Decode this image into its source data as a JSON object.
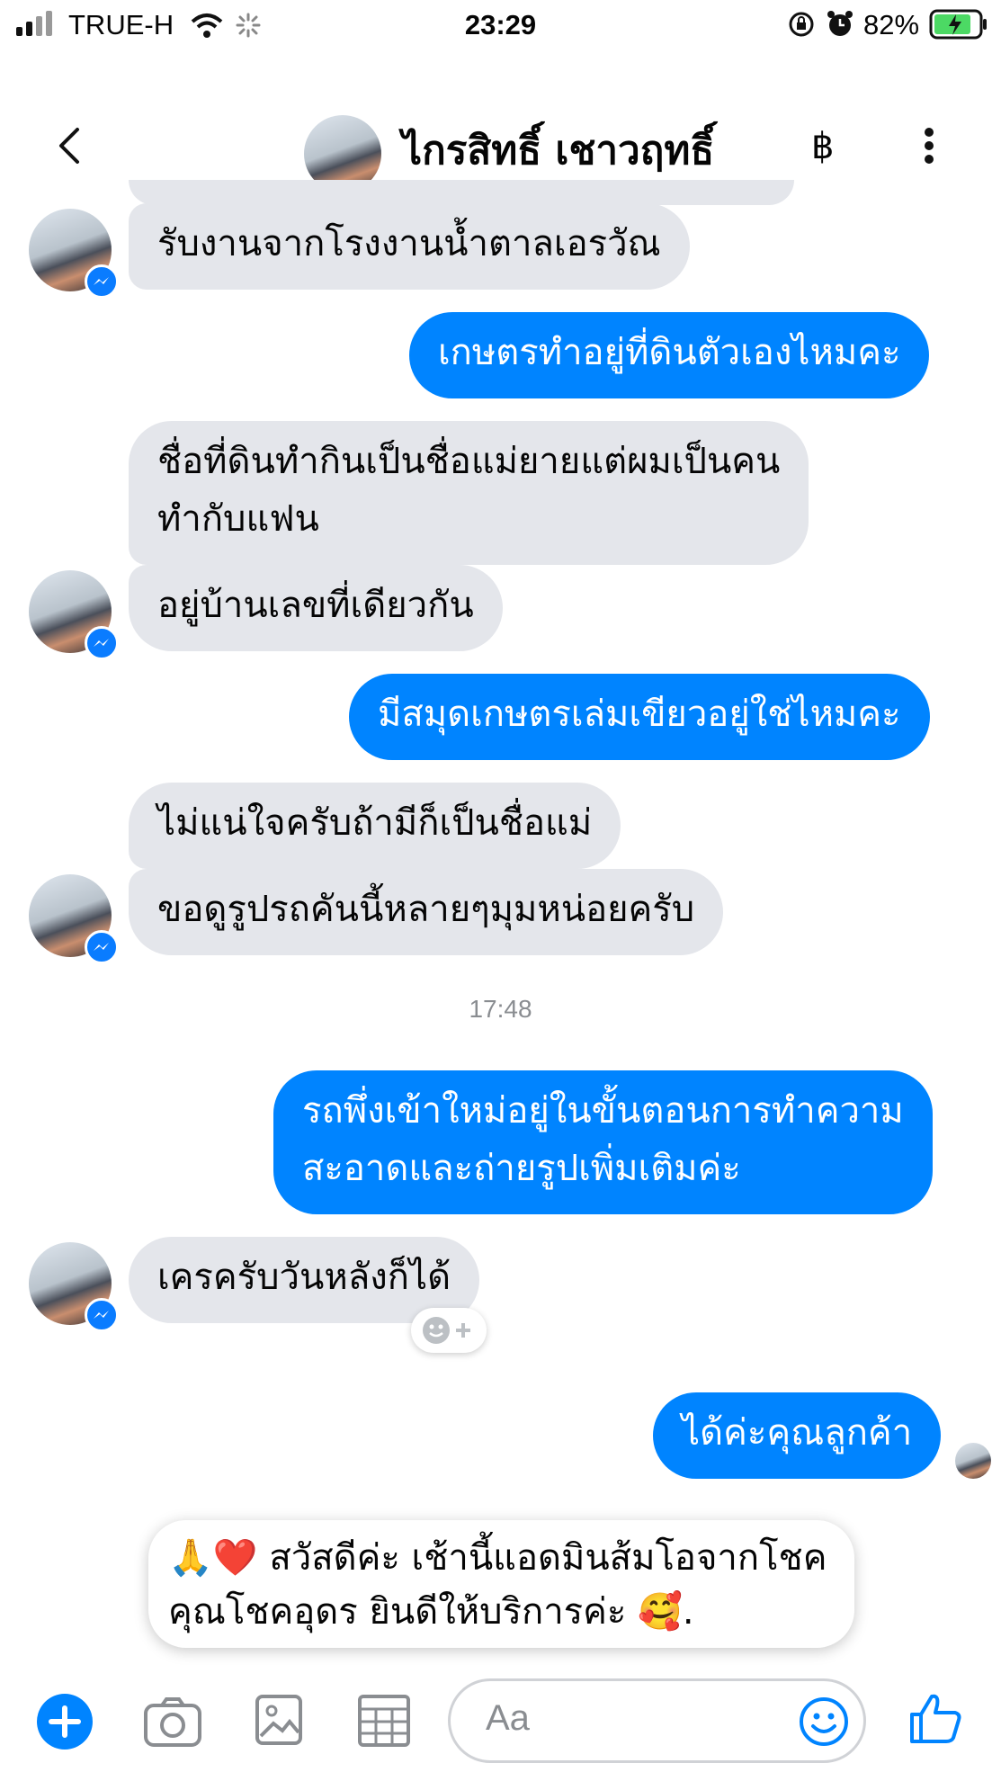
{
  "status_bar": {
    "carrier": "TRUE-H",
    "time": "23:29",
    "battery": "82%"
  },
  "header": {
    "contact_name": "ไกรสิทธิ์ เชาวฤทธิ์",
    "currency_symbol": "฿"
  },
  "messages": [
    {
      "from": "them",
      "text": "รับงานจากโรงงานน้ำตาลเอรวัณ"
    },
    {
      "from": "me",
      "text": "เกษตรทำอยู่ที่ดินตัวเองไหมคะ"
    },
    {
      "from": "them",
      "lines": [
        "ชื่อที่ดินทำกินเป็นชื่อแม่ยายแต่ผมเป็นคน",
        "ทำกับแฟน"
      ]
    },
    {
      "from": "them",
      "text": "อยู่บ้านเลขที่เดียวกัน"
    },
    {
      "from": "me",
      "text": "มีสมุดเกษตรเล่มเขียวอยู่ใช่ไหมคะ"
    },
    {
      "from": "them",
      "text": "ไม่แน่ใจครับถ้ามีก็เป็นชื่อแม่"
    },
    {
      "from": "them",
      "text": "ขอดูรูปรถคันนี้หลายๆมุมหน่อยครับ"
    },
    {
      "from": "me",
      "lines": [
        "รถพึ่งเข้าใหม่อยู่ในขั้นตอนการทำความ",
        "สะอาดและถ่ายรูปเพิ่มเติมค่ะ"
      ]
    },
    {
      "from": "them",
      "text": "เครครับวันหลังก็ได้"
    },
    {
      "from": "me",
      "text": "ได้ค่ะคุณลูกค้า"
    }
  ],
  "timestamp": "17:48",
  "greeting": {
    "emoji_start": "🙏❤️",
    "line1": "สวัสดีค่ะ เช้านี้แอดมินส้มโอจากโชค",
    "line2": "คุณโชคอุดร ยินดีให้บริการค่ะ",
    "emoji_end": "🥰."
  },
  "composer": {
    "placeholder": "Aa"
  },
  "colors": {
    "accent": "#0084ff",
    "them_bubble": "#e4e6eb",
    "battery": "#4cd964"
  },
  "icons": [
    "back-icon",
    "more-icon",
    "messenger-badge-icon",
    "add-icon",
    "camera-icon",
    "gallery-icon",
    "sticker-grid-icon",
    "emoji-icon",
    "thumbs-up-icon",
    "reaction-add-icon"
  ]
}
